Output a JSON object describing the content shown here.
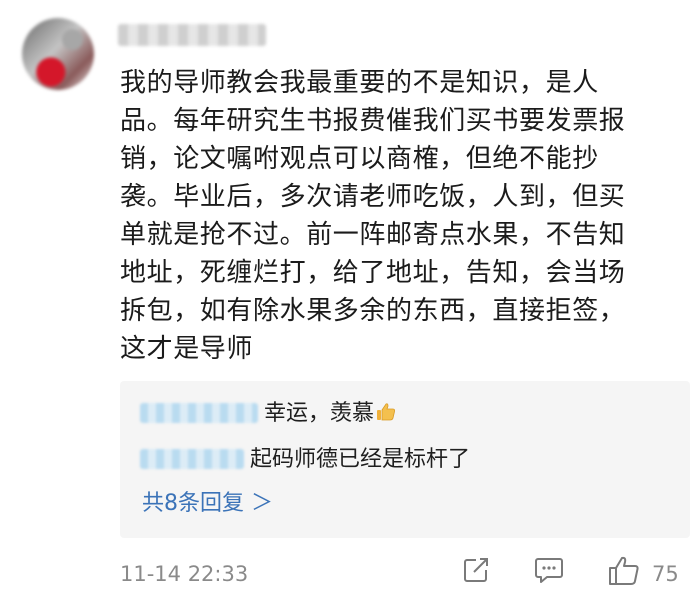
{
  "comment": {
    "text": "我的导师教会我最重要的不是知识，是人\n品。每年研究生书报费催我们买书要发票报\n销，论文嘱咐观点可以商榷，但绝不能抄\n袭。毕业后，多次请老师吃饭，人到，但买\n单就是抢不过。前一阵邮寄点水果，不告知\n地址，死缠烂打，给了地址，告知，会当场\n拆包，如有除水果多余的东西，直接拒签，\n这才是导师",
    "timestamp": "11-14 22:33",
    "like_count": "75"
  },
  "replies": [
    {
      "text": "幸运，羡慕",
      "emoji": "thumbs-up-icon"
    },
    {
      "text": "起码师德已经是标杆了"
    }
  ],
  "more_replies_label": "共8条回复 ＞",
  "colors": {
    "link": "#3b73b8",
    "reply_bg": "#f5f5f5",
    "meta": "#8a8a8a"
  },
  "icons": [
    "share-icon",
    "comment-icon",
    "like-icon"
  ]
}
